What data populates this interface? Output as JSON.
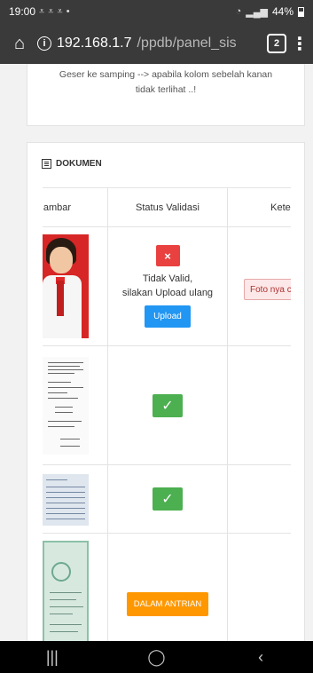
{
  "status_bar": {
    "time": "19:00",
    "battery": "44%"
  },
  "browser": {
    "url_host": "192.168.1.7",
    "url_path": "/ppdb/panel_sis",
    "tab_count": "2"
  },
  "hint": {
    "line1": "Geser ke samping --> apabila kolom sebelah kanan",
    "line2": "tidak terlihat ..!"
  },
  "dokumen": {
    "title": "DOKUMEN",
    "headers": [
      "ambar",
      "Status Validasi",
      "Keterang"
    ],
    "rows": [
      {
        "thumb": "student-photo",
        "status": "invalid",
        "x_label": "×",
        "text1": "Tidak Valid,",
        "text2": "silakan Upload ulang",
        "button": "Upload",
        "note": "Foto nya c"
      },
      {
        "thumb": "document-scan",
        "status": "valid",
        "check": "✓"
      },
      {
        "thumb": "family-card",
        "status": "valid",
        "check": "✓"
      },
      {
        "thumb": "birth-certificate",
        "status": "queued",
        "button": "DALAM ANTRIAN"
      }
    ]
  },
  "colors": {
    "danger": "#e94040",
    "primary": "#2196f3",
    "success": "#4caf50",
    "warning": "#ff9800"
  }
}
